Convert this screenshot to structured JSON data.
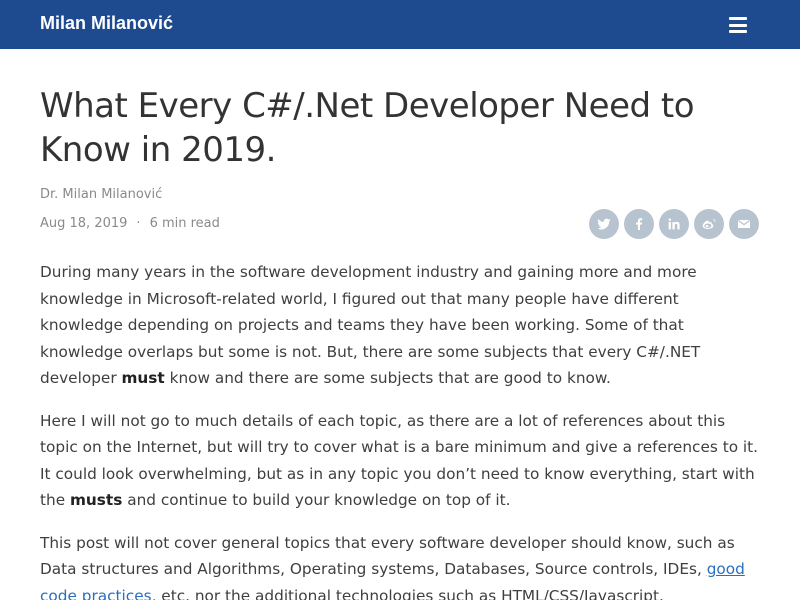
{
  "header": {
    "brand": "Milan Milanović",
    "menu_icon": "hamburger-menu-icon",
    "background": "#1e4b8f"
  },
  "post": {
    "title": "What Every C#/.Net Developer Need to Know in 2019.",
    "author": "Dr. Milan Milanović",
    "date": "Aug 18, 2019",
    "separator": "·",
    "read_time": "6 min read"
  },
  "share": [
    {
      "name": "twitter",
      "icon": "twitter-icon"
    },
    {
      "name": "facebook",
      "icon": "facebook-icon"
    },
    {
      "name": "linkedin",
      "icon": "linkedin-icon"
    },
    {
      "name": "weibo",
      "icon": "weibo-icon"
    },
    {
      "name": "email",
      "icon": "email-icon"
    }
  ],
  "content": {
    "p1": {
      "before": "During many years in the software development industry and gaining more and more knowledge in Microsoft-related world, I figured out that many people have different knowledge depending on projects and teams they have been working. Some of that knowledge overlaps but some is not. But, there are some subjects that every C#/.NET developer ",
      "bold": "must",
      "after": " know and there are some subjects that are good to know."
    },
    "p2": {
      "before": "Here I will not go to much details of each topic, as there are a lot of references about this topic on the Internet, but will try to cover what is a bare minimum and give a references to it. It could look overwhelming, but as in any topic you don’t need to know everything, start with the ",
      "bold": "musts",
      "after": " and continue to build your knowledge on top of it."
    },
    "p3": {
      "before": "This post will not cover general topics that every software developer should know, such as Data structures and Algorithms, Operating systems, Databases, Source controls, IDEs, ",
      "link": "good code practices",
      "after": ", etc. nor the additional technologies such as HTML/CSS/Javascript."
    }
  },
  "colors": {
    "share_bg": "#b7c3cf",
    "link": "#2a6fbf",
    "meta_text": "#8a8a8a"
  }
}
